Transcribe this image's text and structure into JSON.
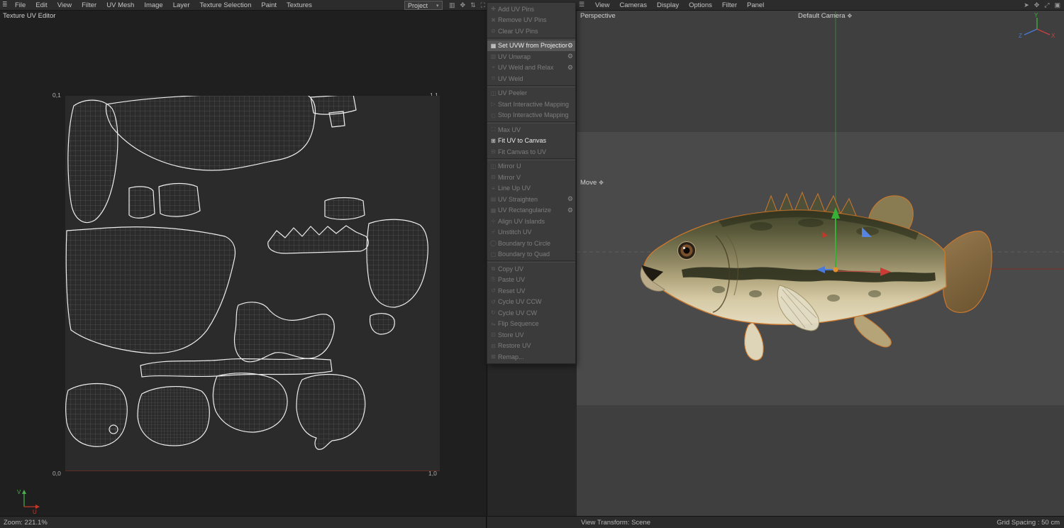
{
  "colors": {
    "topbar_bg": "#2c2c2c",
    "panel_bg": "#1f1f1f",
    "uv_canvas_bg": "#2b2b2b",
    "viewport_outer": "#3f3f3f",
    "viewport_inner": "#4a4a4a",
    "context_menu_bg": "#3b3b3b",
    "context_highlight": "#565656",
    "selection_orange": "#c8772f",
    "axis_x_red": "#c94040",
    "axis_y_green": "#3fae3f",
    "axis_z_blue": "#4a79d8"
  },
  "topbar_left": {
    "lead_icon": {
      "name": "panel-menu-icon",
      "glyph": "≣"
    },
    "menu_items": [
      "File",
      "Edit",
      "View",
      "Filter",
      "UV Mesh",
      "Image",
      "Layer",
      "Texture Selection",
      "Paint",
      "Textures"
    ],
    "project_dropdown": {
      "label": "Project",
      "chevron": "▾"
    },
    "icons": [
      {
        "name": "histogram-icon",
        "glyph": "▥"
      },
      {
        "name": "pan-icon",
        "glyph": "✥"
      },
      {
        "name": "scroll-icon",
        "glyph": "⇅"
      },
      {
        "name": "maximize-icon",
        "glyph": "⛶"
      }
    ]
  },
  "topbar_right": {
    "hamburger_icon": {
      "name": "hamburger-icon",
      "glyph": "☰"
    },
    "menu_items": [
      "View",
      "Cameras",
      "Display",
      "Options",
      "Filter",
      "Panel"
    ],
    "icons": [
      {
        "name": "cursor-icon",
        "glyph": "➤"
      },
      {
        "name": "pan-icon",
        "glyph": "✥"
      },
      {
        "name": "zoom-icon",
        "glyph": "⤢"
      },
      {
        "name": "window-icon",
        "glyph": "▣"
      }
    ]
  },
  "uv_editor": {
    "title": "Texture UV Editor",
    "corner_labels": {
      "top_left": "0,1",
      "top_right": "1,1",
      "bottom_left": "0,0",
      "bottom_right": "1,0"
    },
    "axis": {
      "u": "U",
      "v": "V"
    },
    "status": "Zoom: 221.1%"
  },
  "viewport": {
    "view_label": "Perspective",
    "camera_label": "Default Camera",
    "camera_icon": "✥",
    "tool_label": "Move",
    "tool_icon": "✥",
    "status_left": "View Transform: Scene",
    "status_right": "Grid Spacing : 50 cm",
    "axis_gizmo": {
      "x": "X",
      "y": "Y",
      "z": "Z"
    }
  },
  "context_menu": {
    "items": [
      {
        "label": "Add UV Pins",
        "icon": "✚",
        "enabled": false
      },
      {
        "label": "Remove UV Pins",
        "icon": "✖",
        "enabled": false
      },
      {
        "label": "Clear UV Pins",
        "icon": "⊘",
        "enabled": false,
        "sep_after": true
      },
      {
        "label": "Set UVW from Projection",
        "icon": "▦",
        "enabled": true,
        "highlighted": true,
        "gear": true
      },
      {
        "label": "UV Unwrap",
        "icon": "▧",
        "enabled": false,
        "gear": true
      },
      {
        "label": "UV Weld and Relax",
        "icon": "⌖",
        "enabled": false,
        "gear": true
      },
      {
        "label": "UV Weld",
        "icon": "⌑",
        "enabled": false,
        "sep_after": true
      },
      {
        "label": "UV Peeler",
        "icon": "◫",
        "enabled": false
      },
      {
        "label": "Start Interactive Mapping",
        "icon": "▷",
        "enabled": false
      },
      {
        "label": "Stop Interactive Mapping",
        "icon": "◻",
        "enabled": false,
        "sep_after": true
      },
      {
        "label": "Max UV",
        "icon": "⛶",
        "enabled": false
      },
      {
        "label": "Fit UV to Canvas",
        "icon": "⊞",
        "enabled": true
      },
      {
        "label": "Fit Canvas to UV",
        "icon": "⊟",
        "enabled": false,
        "sep_after": true
      },
      {
        "label": "Mirror U",
        "icon": "◫",
        "enabled": false
      },
      {
        "label": "Mirror V",
        "icon": "⊟",
        "enabled": false
      },
      {
        "label": "Line Up UV",
        "icon": "≡",
        "enabled": false
      },
      {
        "label": "UV Straighten",
        "icon": "▤",
        "enabled": false,
        "gear": true
      },
      {
        "label": "UV Rectangularize",
        "icon": "▦",
        "enabled": false,
        "gear": true
      },
      {
        "label": "Align UV Islands",
        "icon": "⊹",
        "enabled": false
      },
      {
        "label": "Unstitch UV",
        "icon": "⌿",
        "enabled": false
      },
      {
        "label": "Boundary to Circle",
        "icon": "◯",
        "enabled": false
      },
      {
        "label": "Boundary to Quad",
        "icon": "▢",
        "enabled": false,
        "sep_after": true
      },
      {
        "label": "Copy UV",
        "icon": "⧉",
        "enabled": false
      },
      {
        "label": "Paste UV",
        "icon": "⎘",
        "enabled": false
      },
      {
        "label": "Reset UV",
        "icon": "↺",
        "enabled": false
      },
      {
        "label": "Cycle UV CCW",
        "icon": "↺",
        "enabled": false
      },
      {
        "label": "Cycle UV CW",
        "icon": "↻",
        "enabled": false
      },
      {
        "label": "Flip Sequence",
        "icon": "⇋",
        "enabled": false
      },
      {
        "label": "Store UV",
        "icon": "⊡",
        "enabled": false
      },
      {
        "label": "Restore UV",
        "icon": "⊟",
        "enabled": false
      },
      {
        "label": "Remap...",
        "icon": "⊠",
        "enabled": false
      }
    ],
    "gear_glyph": "⚙"
  }
}
